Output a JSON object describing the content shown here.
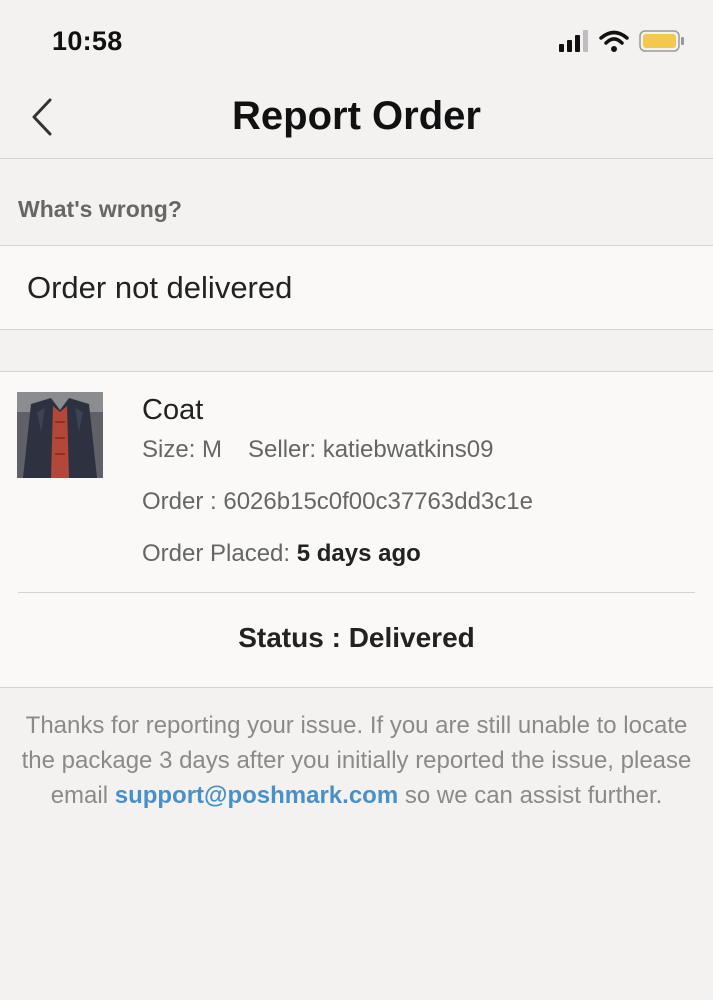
{
  "status_bar": {
    "time": "10:58"
  },
  "nav": {
    "title": "Report Order"
  },
  "section": {
    "label": "What's wrong?"
  },
  "issue": {
    "selected": "Order not delivered"
  },
  "order": {
    "item_title": "Coat",
    "size": "Size: M",
    "seller": "Seller: katiebwatkins09",
    "order_id": "Order : 6026b15c0f00c37763dd3c1e",
    "placed_label": "Order Placed: ",
    "placed_value": "5 days ago",
    "status": "Status : Delivered"
  },
  "footer": {
    "text_before": "Thanks for reporting your issue. If you are still unable to locate the package 3 days after you initially reported the issue, please email ",
    "email": "support@poshmark.com",
    "text_after": " so we can assist further."
  },
  "colors": {
    "link": "#4a90c8",
    "battery": "#f2c94c"
  }
}
